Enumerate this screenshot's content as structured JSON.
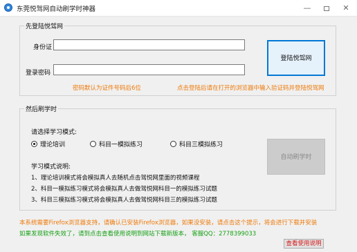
{
  "window": {
    "title": "东莞悦驾网自动刷学时神器"
  },
  "login_section": {
    "legend": "先登陆悦驾网",
    "id_label": "身份证",
    "id_value": "",
    "password_label": "登录密码",
    "password_value": "",
    "password_hint": "密码默认为证件号码后6位",
    "login_button": "登陆悦驾网",
    "login_hint": "点击登陆后请在打开的浏览器中输入验证码并登陆悦驾网"
  },
  "study_section": {
    "legend": "然后刷学时",
    "mode_prompt": "请选择学习模式:",
    "modes": [
      {
        "label": "理论培训",
        "checked": true
      },
      {
        "label": "科目一模拟练习",
        "checked": false
      },
      {
        "label": "科目三模拟练习",
        "checked": false
      }
    ],
    "desc_title": "学习模式说明:",
    "descriptions": [
      "1、理论培训模式将会模拟真人去随机点击驾悦网里面的视频课程",
      "2、科目一模拟练习模式将会模拟真人去做驾悦网科目一的模拟练习试题",
      "3、科目三模拟练习模式将会模拟真人去做驾悦网科目三的模拟练习试题"
    ],
    "start_button": "自动刷学时"
  },
  "footer": {
    "firefox_notice": "本系统需要Firefox浏览器支持，请确认已安装Firefox浏览器，如果没安装，请点击这个提示，将会进行下载并安装",
    "update_notice": "如果发现软件失效了，请到点击查看使用说明到网站下载新版本， 客服QQ：2778399033",
    "usage_button": "查看使用说明"
  },
  "colors": {
    "accent_blue": "#0078d7",
    "hint_orange": "#ee7a0a",
    "notice_green": "#15a015",
    "usage_red": "#d61a1a"
  }
}
